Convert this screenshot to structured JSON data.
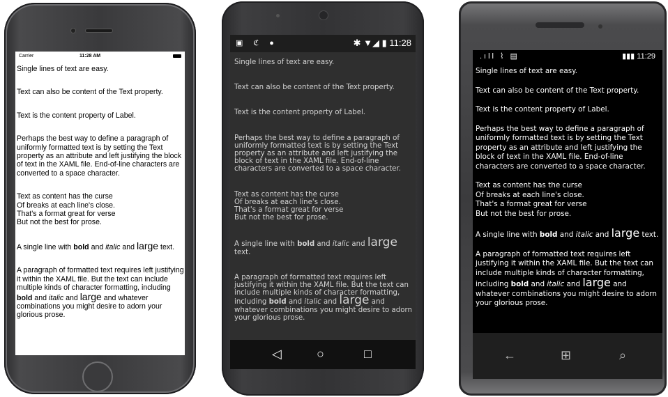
{
  "iphone": {
    "status": {
      "carrier": "Carrier",
      "time": "11:28 AM"
    },
    "paragraphs": {
      "p1": "Single lines of text are easy.",
      "p2": "Text can also be content of the Text property.",
      "p3": "Text is the content property of Label.",
      "p4": "Perhaps the best way to define a paragraph of uniformly formatted text is by setting the Text property as an attribute and left justifying the block of text in the XAML file. End-of-line characters are converted to a space character.",
      "verse": [
        "Text as content has the curse",
        "Of breaks at each line's close.",
        "That's a format great for verse",
        "But not the best for prose."
      ],
      "formatted_line": {
        "a": "A single line with ",
        "bold": "bold",
        "b": " and ",
        "italic": "italic",
        "c": " and ",
        "large": "large",
        "d": " text."
      },
      "p7": {
        "a": "A paragraph of formatted text requires left justifying it within the XAML file. But the text can include multiple kinds of character formatting, including ",
        "bold": "bold",
        "b": " and ",
        "italic": "italic",
        "c": " and ",
        "large": "large",
        "d": " and whatever combinations you might desire to adorn your glorious prose."
      }
    }
  },
  "android": {
    "status": {
      "left_icons": "▣ ℭ ●",
      "right": "✱ ▼◢ ▮ 11:28"
    },
    "paragraphs": {
      "p1": "Single lines of text are easy.",
      "p2": "Text can also be content of the Text property.",
      "p3": "Text is the content property of Label.",
      "p4": "Perhaps the best way to define a paragraph of uniformly formatted text is by setting the Text property as an attribute and left justifying the block of text in the XAML file. End-of-line characters are converted to a space character.",
      "verse": [
        "Text as content has the curse",
        "Of breaks at each line's close.",
        "That's a format great for verse",
        "But not the best for prose."
      ],
      "formatted_line": {
        "a": "A single line with ",
        "bold": "bold",
        "b": " and ",
        "italic": "italic",
        "c": " and ",
        "large": "large",
        "d": " text."
      },
      "p7": {
        "a": "A paragraph of formatted text requires left justifying it within the XAML file. But the text can include multiple kinds of character formatting, including ",
        "bold": "bold",
        "b": " and ",
        "italic": "italic",
        "c": " and ",
        "large": "large",
        "d": " and whatever combinations you might desire to adorn your glorious prose."
      }
    },
    "nav": {
      "back": "◁",
      "home": "○",
      "recents": "□"
    }
  },
  "windows_phone": {
    "status": {
      "left_icons": ".ıll ⌇ ▤",
      "right": "▮▮▮ 11:29"
    },
    "paragraphs": {
      "p1": "Single lines of text are easy.",
      "p2": "Text can also be content of the Text property.",
      "p3": "Text is the content property of Label.",
      "p4": "Perhaps the best way to define a paragraph of uniformly formatted text is by setting the Text property as an attribute and left justifying the block of text in the XAML file. End-of-line characters are converted to a space character.",
      "verse": [
        "Text as content has the curse",
        "Of breaks at each line's close.",
        "That's a format great for verse",
        "But not the best for prose."
      ],
      "formatted_line": {
        "a": "A single line with ",
        "bold": "bold",
        "b": " and ",
        "italic": "italic",
        "c": " and ",
        "large": "large",
        "d": " text."
      },
      "p7": {
        "a": "A paragraph of formatted text requires left justifying it within the XAML file. But the text can include multiple kinds of character formatting, including ",
        "bold": "bold",
        "b": " and ",
        "italic": "italic",
        "c": " and ",
        "large": "large",
        "d": " and whatever combinations you might desire to adorn your glorious prose."
      }
    },
    "nav": {
      "back": "←",
      "start": "⊞",
      "search": "⌕"
    }
  }
}
